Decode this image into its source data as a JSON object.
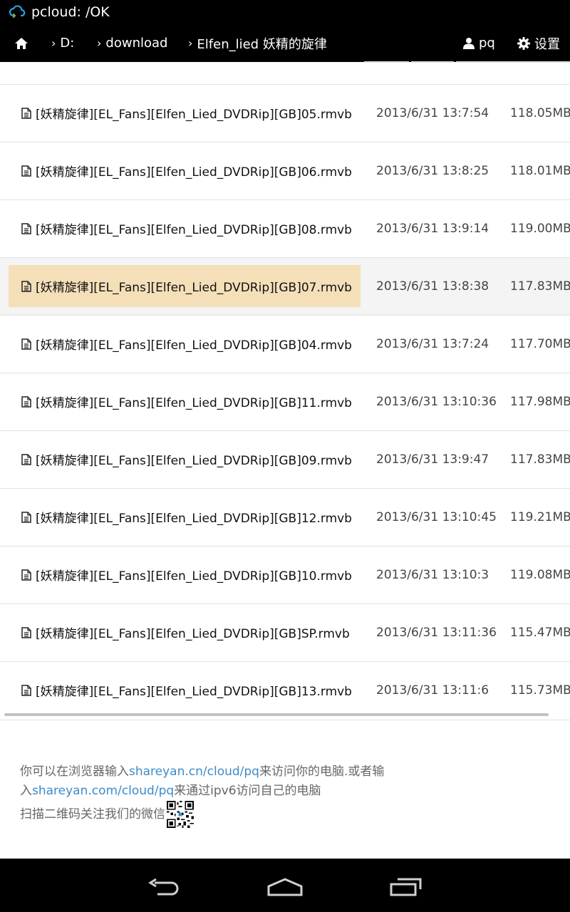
{
  "app": {
    "title": "pcloud: /OK"
  },
  "nav": {
    "home_icon": "home-icon",
    "crumbs": [
      "D:",
      "download",
      "Elfen_lied 妖精的旋律"
    ],
    "user": "pq",
    "settings": "设置"
  },
  "files": [
    {
      "name": "[妖精旋律][EL_Fans][Elfen_Lied_DVDRip][GB]05.rmvb",
      "date": "2013/6/31 13:7:54",
      "size": "118.05MB"
    },
    {
      "name": "[妖精旋律][EL_Fans][Elfen_Lied_DVDRip][GB]06.rmvb",
      "date": "2013/6/31 13:8:25",
      "size": "118.01MB"
    },
    {
      "name": "[妖精旋律][EL_Fans][Elfen_Lied_DVDRip][GB]08.rmvb",
      "date": "2013/6/31 13:9:14",
      "size": "119.00MB"
    },
    {
      "name": "[妖精旋律][EL_Fans][Elfen_Lied_DVDRip][GB]07.rmvb",
      "date": "2013/6/31 13:8:38",
      "size": "117.83MB"
    },
    {
      "name": "[妖精旋律][EL_Fans][Elfen_Lied_DVDRip][GB]04.rmvb",
      "date": "2013/6/31 13:7:24",
      "size": "117.70MB"
    },
    {
      "name": "[妖精旋律][EL_Fans][Elfen_Lied_DVDRip][GB]11.rmvb",
      "date": "2013/6/31 13:10:36",
      "size": "117.98MB"
    },
    {
      "name": "[妖精旋律][EL_Fans][Elfen_Lied_DVDRip][GB]09.rmvb",
      "date": "2013/6/31 13:9:47",
      "size": "117.83MB"
    },
    {
      "name": "[妖精旋律][EL_Fans][Elfen_Lied_DVDRip][GB]12.rmvb",
      "date": "2013/6/31 13:10:45",
      "size": "119.21MB"
    },
    {
      "name": "[妖精旋律][EL_Fans][Elfen_Lied_DVDRip][GB]10.rmvb",
      "date": "2013/6/31 13:10:3",
      "size": "119.08MB"
    },
    {
      "name": "[妖精旋律][EL_Fans][Elfen_Lied_DVDRip][GB]SP.rmvb",
      "date": "2013/6/31 13:11:36",
      "size": "115.47MB"
    },
    {
      "name": "[妖精旋律][EL_Fans][Elfen_Lied_DVDRip][GB]13.rmvb",
      "date": "2013/6/31 13:11:6",
      "size": "115.73MB"
    }
  ],
  "footer": {
    "line1_pre": "你可以在浏览器输入",
    "link1": "shareyan.cn/cloud/pq",
    "line1_post": "来访问你的电脑.或者输",
    "line2_pre": "入",
    "link2": "shareyan.com/cloud/pq",
    "line2_post": "来通过ipv6访问自己的电脑",
    "line3": "扫描二维码关注我们的微信"
  },
  "colors": {
    "selected_row": "#f4dfb8",
    "link": "#3c8cc8"
  }
}
